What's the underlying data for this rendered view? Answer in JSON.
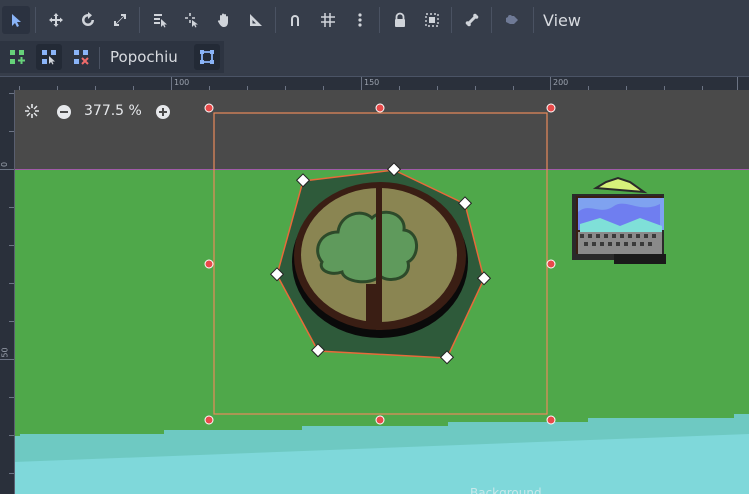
{
  "toolbar": {
    "tools": [
      {
        "name": "select-tool",
        "icon": "cursor-arrow-icon",
        "active": true
      },
      {
        "name": "move-tool",
        "icon": "move-arrows-icon"
      },
      {
        "name": "rotate-tool",
        "icon": "rotate-icon"
      },
      {
        "name": "scale-tool",
        "icon": "scale-icon"
      },
      {
        "name": "list-select-tool",
        "icon": "list-select-icon"
      },
      {
        "name": "pivot-tool",
        "icon": "pivot-icon"
      },
      {
        "name": "pan-tool",
        "icon": "hand-icon"
      },
      {
        "name": "ruler-tool",
        "icon": "ruler-icon"
      },
      {
        "name": "smart-snap-toggle",
        "icon": "magnet-icon"
      },
      {
        "name": "grid-snap-toggle",
        "icon": "grid-icon"
      },
      {
        "name": "snap-options-menu",
        "icon": "more-vertical-icon"
      },
      {
        "name": "lock-button",
        "icon": "lock-icon"
      },
      {
        "name": "group-button",
        "icon": "group-icon"
      },
      {
        "name": "skeleton-button",
        "icon": "bone-icon"
      },
      {
        "name": "camera-override-button",
        "icon": "camera-icon"
      }
    ],
    "view_label": "View"
  },
  "subtoolbar": {
    "plugin_label": "Popochiu",
    "buttons": [
      {
        "name": "add-point-button",
        "icon": "add-point-icon"
      },
      {
        "name": "edit-point-button",
        "icon": "edit-point-icon"
      },
      {
        "name": "delete-point-button",
        "icon": "delete-point-icon"
      },
      {
        "name": "polygon-edit-button",
        "icon": "polygon-icon"
      }
    ]
  },
  "rulers": {
    "horizontal_labels": [
      "100",
      "150",
      "200"
    ],
    "vertical_labels": [
      "0",
      "50"
    ]
  },
  "zoom": {
    "value": "377.5 %",
    "zoom_out_icon": "minus-circle-icon",
    "zoom_in_icon": "plus-circle-icon",
    "reset_icon": "zoom-reset-icon"
  },
  "scene": {
    "bottom_label": "Background",
    "colors": {
      "sky": "#4a4a4a",
      "grass": "#4fa84a",
      "water": "#7fd8da",
      "selection": "#e88a5a",
      "polygon_fill": "#2e5a3a"
    }
  }
}
